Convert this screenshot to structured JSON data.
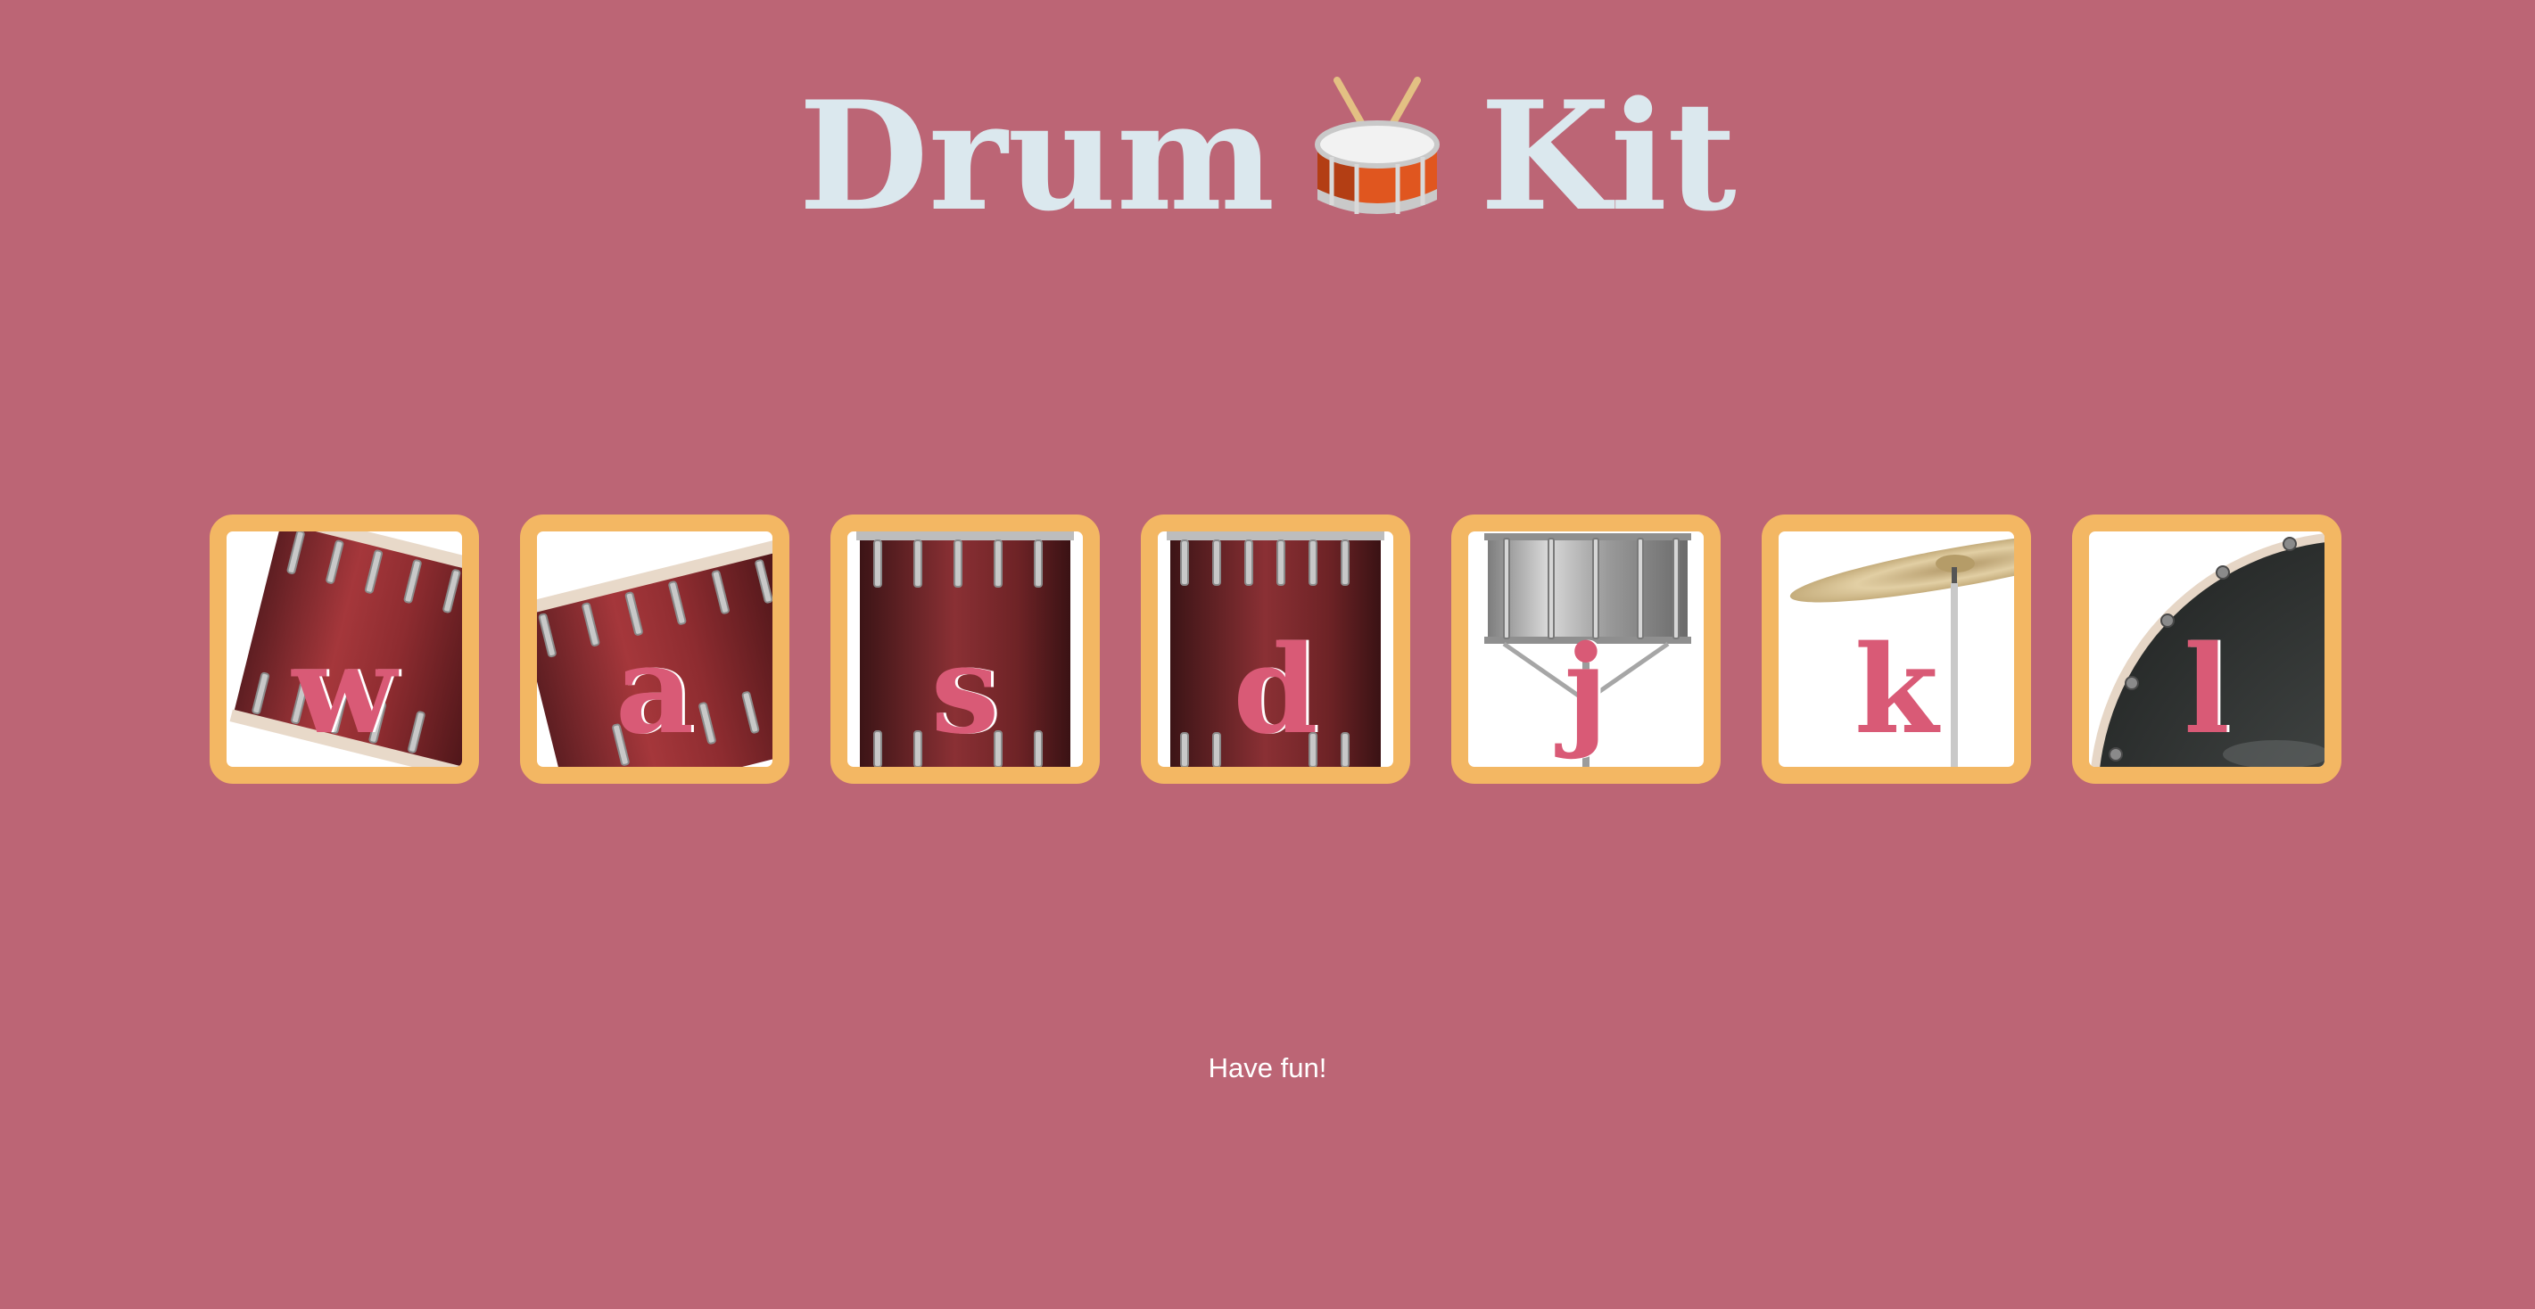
{
  "header": {
    "title_left": "Drum",
    "title_emoji": "drum-with-drumsticks-icon",
    "title_right": "Kit"
  },
  "pads": [
    {
      "key": "w",
      "instrument": "tom-1"
    },
    {
      "key": "a",
      "instrument": "tom-2"
    },
    {
      "key": "s",
      "instrument": "tom-3"
    },
    {
      "key": "d",
      "instrument": "tom-4"
    },
    {
      "key": "j",
      "instrument": "snare"
    },
    {
      "key": "k",
      "instrument": "crash"
    },
    {
      "key": "l",
      "instrument": "kick-bass"
    }
  ],
  "footer": {
    "text": "Have fun!"
  },
  "colors": {
    "background": "#bc6575",
    "title": "#dbe8ee",
    "pad_border": "#f3b763",
    "pad_letter": "#d95a76",
    "footer_text": "#ffffff"
  }
}
